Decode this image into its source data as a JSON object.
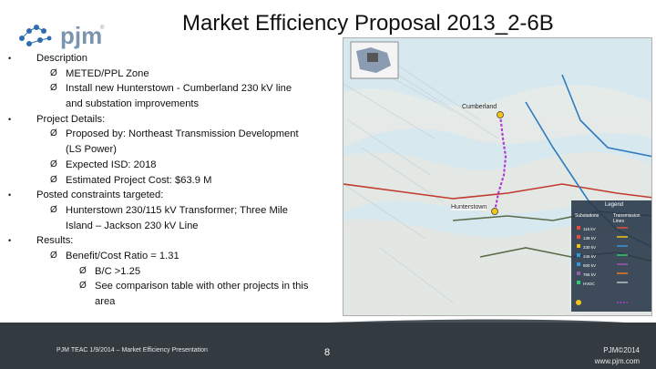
{
  "slide": {
    "title": "Market Efficiency Proposal 2013_2-6B",
    "logo_text": "pjm",
    "logo_tm": "®"
  },
  "content": {
    "rows": [
      {
        "level": 1,
        "text": "Description"
      },
      {
        "level": 2,
        "text": "METED/PPL Zone"
      },
      {
        "level": 2,
        "text": "Install new Hunterstown - Cumberland 230 kV line"
      },
      {
        "level": 2.5,
        "text": "and substation improvements"
      },
      {
        "level": 1,
        "text": "Project Details:"
      },
      {
        "level": 2,
        "text": "Proposed by: Northeast Transmission Development"
      },
      {
        "level": 2.5,
        "text": "(LS Power)"
      },
      {
        "level": 2,
        "text": "Expected ISD: 2018"
      },
      {
        "level": 2,
        "text": "Estimated Project Cost: $63.9 M"
      },
      {
        "level": 1,
        "text": "Posted constraints targeted:"
      },
      {
        "level": 2,
        "text": "Hunterstown 230/115 kV Transformer; Three Mile"
      },
      {
        "level": 2.5,
        "text": "Island – Jackson 230 kV Line"
      },
      {
        "level": 1,
        "text": "Results:"
      },
      {
        "level": 2,
        "text": "Benefit/Cost Ratio = 1.31"
      },
      {
        "level": 3,
        "text": "B/C >1.25"
      },
      {
        "level": 3,
        "text": "See comparison table with other projects in this"
      },
      {
        "level": 3.5,
        "text": "area"
      }
    ],
    "bullet_glyph": "•",
    "arrow_glyph": "Ø"
  },
  "map": {
    "labels": {
      "cumberland": "Cumberland",
      "hunterstown": "Hunterstown",
      "legend_title": "Legend",
      "legend_col1": "Substations",
      "legend_col2": "Transmission Lines"
    },
    "legend_rows": [
      "115 kV",
      "138 kV",
      "230 kV",
      "345 kV",
      "500 kV",
      "765 kV",
      "HVDC"
    ],
    "colors": {
      "water": "#cfe3ee",
      "land": "#e9e4da",
      "proposed_line": "#b23bd1",
      "line_345": "#c0392b",
      "line_230": "#2f7bbf",
      "line_115": "#5b6b4a"
    }
  },
  "footer": {
    "left": "PJM TEAC 1/9/2014 – Market Efficiency Presentation",
    "page": "8",
    "right1": "PJM©2014",
    "right2": "www.pjm.com"
  }
}
